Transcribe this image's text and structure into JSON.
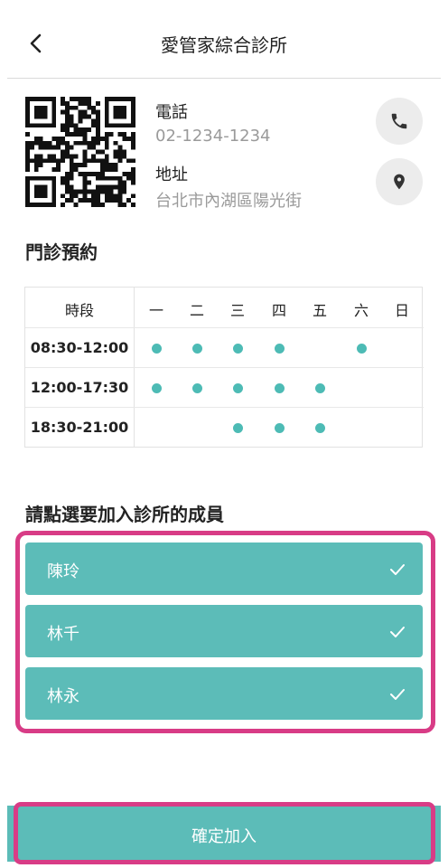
{
  "header": {
    "title": "愛管家綜合診所",
    "back_icon": "chevron-left-icon"
  },
  "clinic": {
    "phone_label": "電話",
    "phone_value": "02-1234-1234",
    "address_label": "地址",
    "address_value": "台北市內湖區陽光街"
  },
  "schedule": {
    "section_title": "門診預約",
    "slot_header": "時段",
    "days": [
      "一",
      "二",
      "三",
      "四",
      "五",
      "六",
      "日"
    ],
    "rows": [
      {
        "slot": "08:30-12:00",
        "open": [
          true,
          true,
          true,
          true,
          false,
          true,
          false
        ]
      },
      {
        "slot": "12:00-17:30",
        "open": [
          true,
          true,
          true,
          true,
          true,
          false,
          false
        ]
      },
      {
        "slot": "18:30-21:00",
        "open": [
          false,
          false,
          true,
          true,
          true,
          false,
          false
        ]
      }
    ],
    "dot_color": "#4dbbb5"
  },
  "members": {
    "section_title": "請點選要加入診所的成員",
    "items": [
      {
        "name": "陳玲",
        "selected": true
      },
      {
        "name": "林千",
        "selected": true
      },
      {
        "name": "林永",
        "selected": true
      }
    ]
  },
  "confirm": {
    "label": "確定加入"
  },
  "colors": {
    "accent": "#5cbcb8",
    "highlight": "#d83c86"
  }
}
